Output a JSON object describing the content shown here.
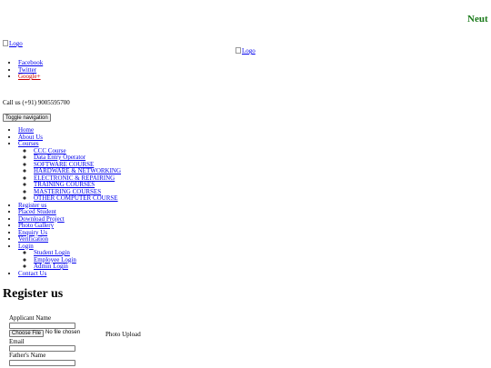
{
  "marquee": {
    "text": "Neut"
  },
  "logos": {
    "left_alt": "Logo",
    "center_alt": "Logo"
  },
  "social": [
    {
      "label": "Facebook"
    },
    {
      "label": "Twitter"
    },
    {
      "label": "Google+"
    }
  ],
  "contact": {
    "call_text": "Call us (+91) 9005595700"
  },
  "toggle": {
    "label": "Toggle navigation"
  },
  "nav": {
    "home": "Home",
    "about": "About Us",
    "courses": "Courses",
    "courses_sub": [
      "CCC Course",
      "Data Entry Operator",
      "SOFTWARE COURSE",
      "HARDWARE & NETWORKING",
      "ELECTRONIC & REPAIRING",
      "TRAINING COURSES",
      "MASTERING COURSES",
      "OTHER COMPUTER COURSE"
    ],
    "register": "Register us",
    "placed": "Placed Student",
    "download": "Download Project",
    "gallery": "Photo Gallery",
    "enquiry": "Enquiry Us",
    "verification": "Verification",
    "login": "Login",
    "login_sub": [
      "Student Login",
      "Employee Login",
      "Admin Login"
    ],
    "contact": "Contact Us"
  },
  "page": {
    "title": "Register us"
  },
  "form": {
    "applicant_label": "Applicant Name",
    "file_button": "Choose File",
    "file_status": "No file chosen",
    "photo_label": "Photo Upload",
    "email_label": "Email",
    "father_label": "Father's Name"
  }
}
